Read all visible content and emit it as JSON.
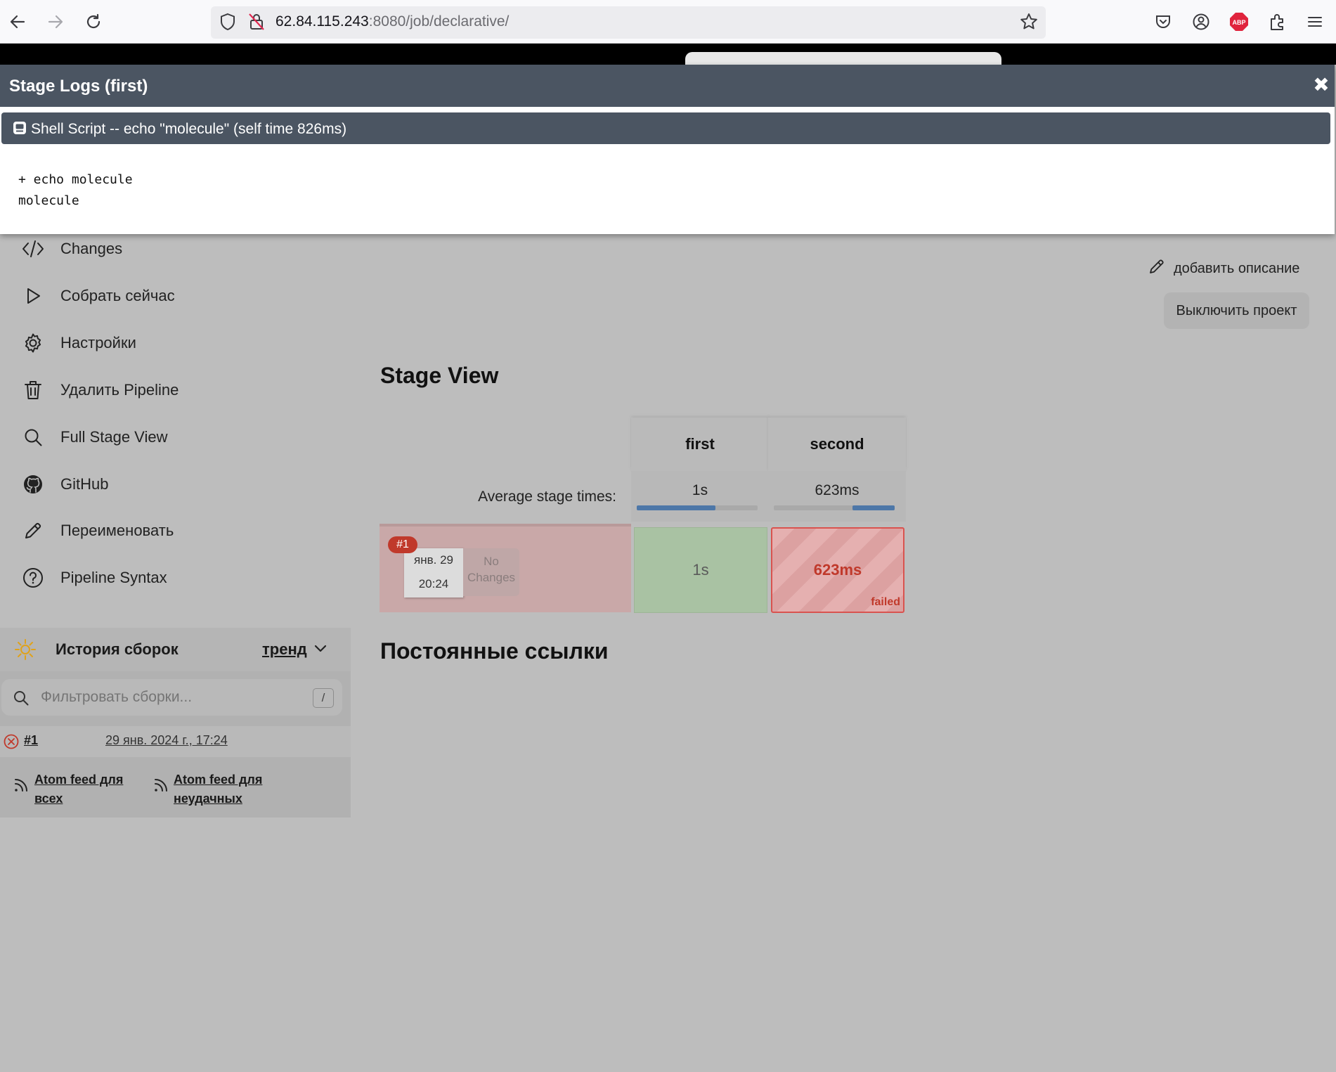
{
  "browser": {
    "url_host": "62.84.115.243",
    "url_path": ":8080/job/declarative/",
    "abp_label": "ABP"
  },
  "modal": {
    "title": "Stage Logs (first)",
    "close_label": "✖",
    "step_title": "Shell Script -- echo \"molecule\" (self time 826ms)",
    "log_lines": [
      "+ echo molecule",
      "molecule"
    ]
  },
  "sidebar": {
    "items": [
      {
        "label": "Changes",
        "icon": "code-icon"
      },
      {
        "label": "Собрать сейчас",
        "icon": "play-icon"
      },
      {
        "label": "Настройки",
        "icon": "gear-icon"
      },
      {
        "label": "Удалить Pipeline",
        "icon": "trash-icon"
      },
      {
        "label": "Full Stage View",
        "icon": "search-icon"
      },
      {
        "label": "GitHub",
        "icon": "github-icon"
      },
      {
        "label": "Переименовать",
        "icon": "pencil-icon"
      },
      {
        "label": "Pipeline Syntax",
        "icon": "help-icon"
      }
    ]
  },
  "history": {
    "title": "История сборок",
    "trend_label": "тренд",
    "filter_placeholder": "Фильтровать сборки...",
    "filter_shortcut": "/",
    "builds": [
      {
        "number": "#1",
        "date": "29 янв. 2024 г., 17:24",
        "status": "failed"
      }
    ],
    "feed_all": "Atom feed для всех",
    "feed_all_line1": "Atom feed для",
    "feed_all_line2": "всех",
    "feed_failed_line1": "Atom feed для",
    "feed_failed_line2": "неудачных"
  },
  "main": {
    "add_description": "добавить описание",
    "disable_project": "Выключить проект",
    "stage_view_title": "Stage View",
    "permalinks_title": "Постоянные ссылки"
  },
  "stage_view": {
    "stages": [
      "first",
      "second"
    ],
    "avg_label": "Average stage times:",
    "avg_times": [
      "1s",
      "623ms"
    ],
    "avg_bar_fraction": [
      0.65,
      0.35
    ],
    "runs": [
      {
        "badge": "#1",
        "date": "янв. 29",
        "time": "20:24",
        "changes_line1": "No",
        "changes_line2": "Changes",
        "stage_results": [
          {
            "duration": "1s",
            "status": "success"
          },
          {
            "duration": "623ms",
            "status": "failed",
            "tag": "failed"
          }
        ]
      }
    ]
  },
  "colors": {
    "modal_header": "#4b5562",
    "failed_red": "#c0392b",
    "success_green": "#a9c2a3",
    "bar_blue": "#4d77a8"
  }
}
